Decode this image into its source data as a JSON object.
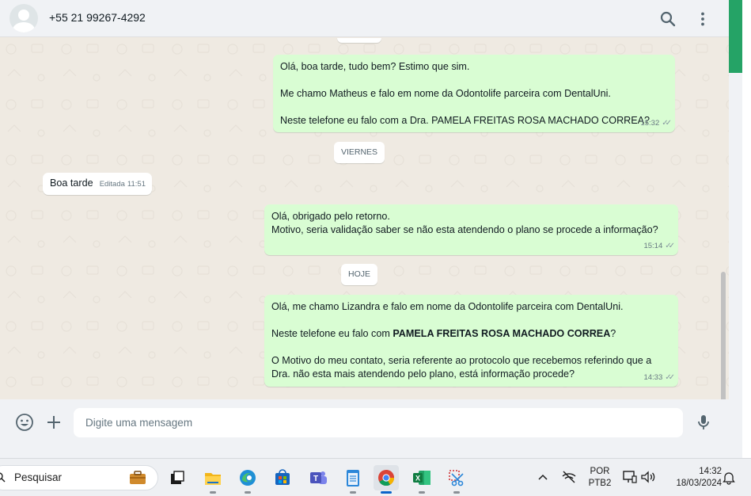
{
  "header": {
    "contact": "+55 21 99267-4292",
    "icons": [
      "avatar-icon",
      "search-icon",
      "menu-icon"
    ]
  },
  "messages": [
    {
      "direction": "out",
      "paragraphs": [
        "Olá, boa tarde, tudo bem? Estimo que sim.",
        "Me chamo Matheus e falo em nome da Odontolife parceira com DentalUni.",
        "Neste telefone eu falo com a Dra. PAMELA FREITAS ROSA MACHADO CORREA?"
      ],
      "time": "15:32"
    },
    {
      "type": "date",
      "label": "VIERNES"
    },
    {
      "direction": "in",
      "text": "Boa tarde",
      "edited": "Editada",
      "time": "11:51"
    },
    {
      "direction": "out",
      "lines": [
        "Olá, obrigado pelo retorno.",
        "Motivo, seria validação saber se não esta atendendo o plano se procede a informação?"
      ],
      "time": "15:14"
    },
    {
      "type": "date",
      "label": "HOJE"
    },
    {
      "direction": "out",
      "p1": "Olá, me chamo Lizandra e falo em nome da Odontolife parceira com DentalUni.",
      "p2_prefix": "Neste telefone eu falo com ",
      "p2_bold": "PAMELA FREITAS ROSA MACHADO CORREA",
      "p2_suffix": "?",
      "p3_line1": "O Motivo do meu contato, seria referente ao protocolo que recebemos referindo que a",
      "p3_line2": "Dra. não esta mais atendendo pelo plano, está informação procede?",
      "time": "14:33"
    }
  ],
  "composer": {
    "placeholder": "Digite uma mensagem",
    "icons": [
      "emoji-icon",
      "plus-icon",
      "mic-icon"
    ]
  },
  "taskbar": {
    "search_label": "Pesquisar",
    "apps": [
      "widgets-icon",
      "task-view-icon",
      "file-explorer-icon",
      "edge-icon",
      "store-icon",
      "teams-icon",
      "notepad-icon",
      "chrome-icon",
      "excel-icon",
      "snipping-tool-icon"
    ],
    "active_app": "chrome-icon",
    "language_line1": "POR",
    "language_line2": "PTB2",
    "time": "14:32",
    "date": "18/03/2024"
  },
  "colors": {
    "outgoing_bubble": "#d9fdd3",
    "incoming_bubble": "#ffffff",
    "chat_background": "#efeae2",
    "accent": "#25a366",
    "panel": "#f0f2f5"
  }
}
